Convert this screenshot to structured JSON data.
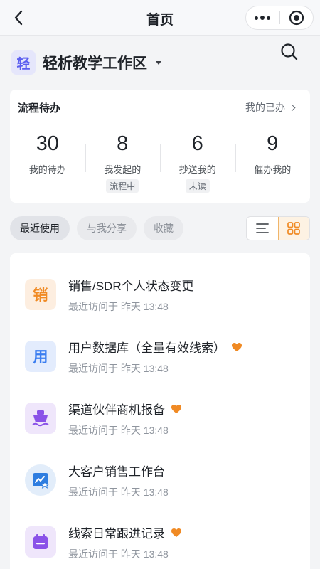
{
  "nav": {
    "title": "首页",
    "back_icon": "chevron-left-icon",
    "more_icon": "more-dots-icon",
    "close_icon": "record-circle-icon"
  },
  "workspace": {
    "logo_char": "轻",
    "name": "轻析教学工作区"
  },
  "todo": {
    "title": "流程待办",
    "link_label": "我的已办",
    "stats": [
      {
        "value": "30",
        "label": "我的待办",
        "tag": ""
      },
      {
        "value": "8",
        "label": "我发起的",
        "tag": "流程中"
      },
      {
        "value": "6",
        "label": "抄送我的",
        "tag": "未读"
      },
      {
        "value": "9",
        "label": "催办我的",
        "tag": ""
      }
    ]
  },
  "tabs": [
    {
      "label": "最近使用",
      "active": true
    },
    {
      "label": "与我分享",
      "active": false
    },
    {
      "label": "收藏",
      "active": false
    }
  ],
  "view_toggle": {
    "list_icon": "list-view-icon",
    "grid_icon": "grid-view-icon",
    "active": "grid"
  },
  "apps": [
    {
      "title": "销售/SDR个人状态变更",
      "subtitle": "最近访问于 昨天 13:48",
      "icon_text": "销",
      "icon": "sales-icon",
      "favorite": false,
      "bg": "#fdeee0",
      "fg": "#f08a24"
    },
    {
      "title": "用户数据库（全量有效线索）",
      "subtitle": "最近访问于 昨天 13:48",
      "icon_text": "用",
      "icon": "users-icon",
      "favorite": true,
      "bg": "#e3ecfd",
      "fg": "#3a7df0"
    },
    {
      "title": "渠道伙伴商机报备",
      "subtitle": "最近访问于 昨天 13:48",
      "icon_text": "",
      "icon": "ship-icon",
      "favorite": true,
      "bg": "#efe6fb",
      "fg": "#8a52e8"
    },
    {
      "title": "大客户销售工作台",
      "subtitle": "最近访问于 昨天 13:48",
      "icon_text": "",
      "icon": "dashboard-chart-icon",
      "favorite": false,
      "bg": "#e2edfa",
      "fg": "#2e7de0"
    },
    {
      "title": "线索日常跟进记录",
      "subtitle": "最近访问于 昨天 13:48",
      "icon_text": "",
      "icon": "calendar-icon",
      "favorite": true,
      "bg": "#efe6fb",
      "fg": "#8a52e8"
    }
  ],
  "colors": {
    "accent": "#f08a24",
    "favorite": "#f08a24",
    "background": "#f3f4f6"
  }
}
